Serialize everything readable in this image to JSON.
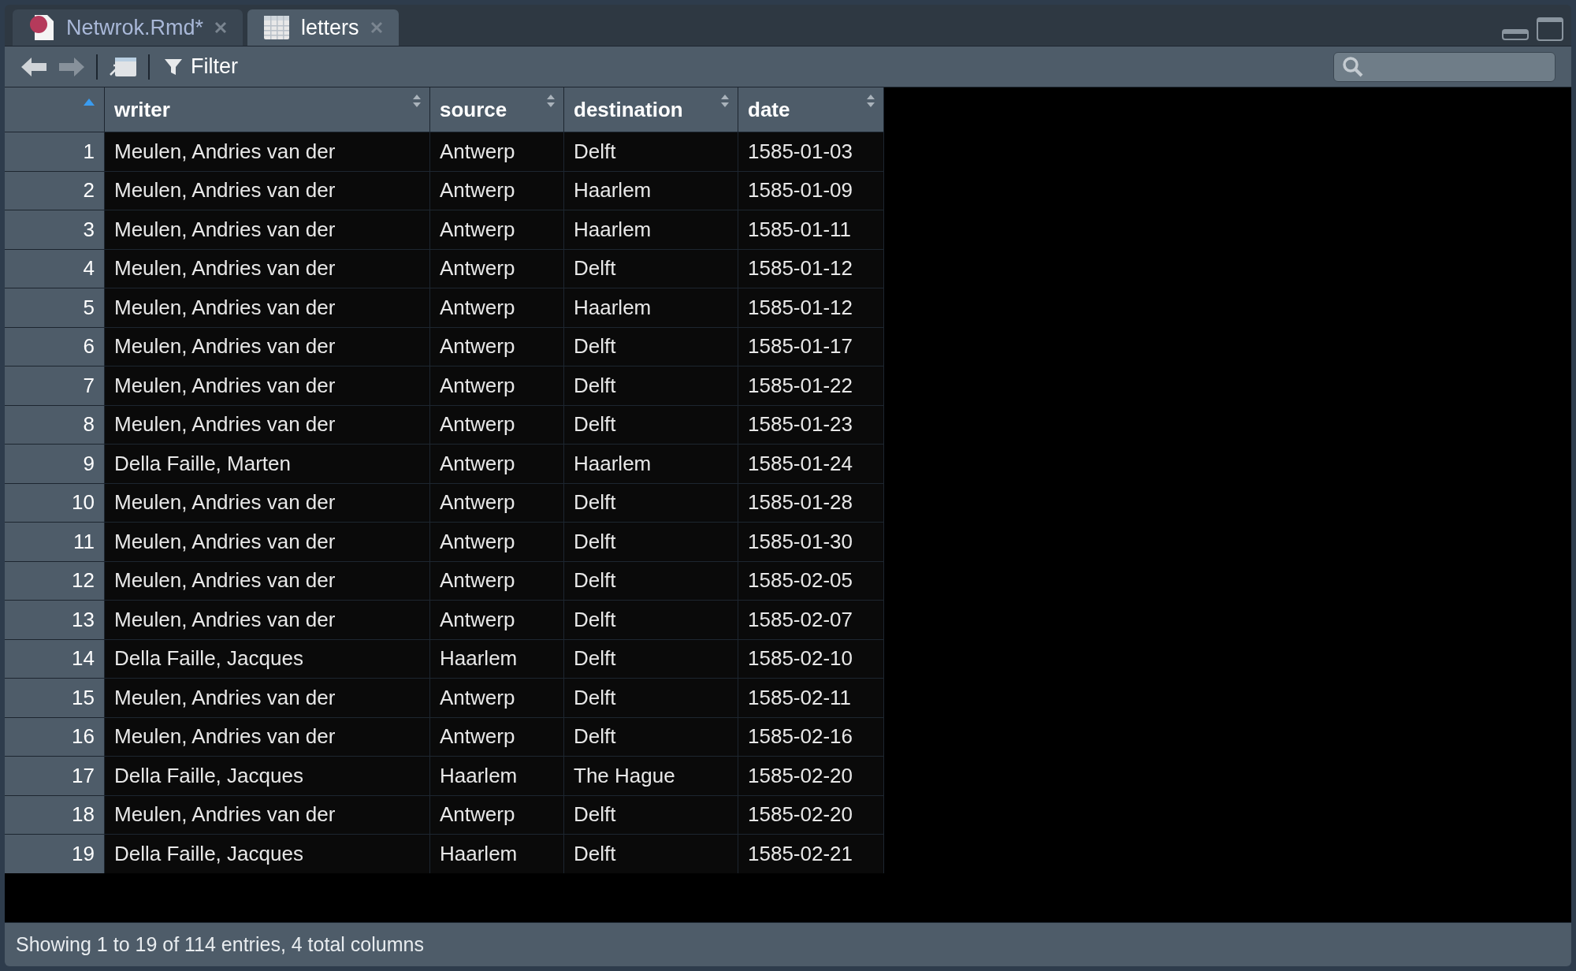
{
  "tabs": [
    {
      "label": "Netwrok.Rmd*",
      "kind": "rmd",
      "selected": false
    },
    {
      "label": "letters",
      "kind": "data",
      "selected": true
    }
  ],
  "toolbar": {
    "filter_label": "Filter"
  },
  "table": {
    "columns": [
      "writer",
      "source",
      "destination",
      "date"
    ],
    "rows": [
      {
        "row_number": "1",
        "cells": [
          "Meulen, Andries van der",
          "Antwerp",
          "Delft",
          "1585-01-03"
        ]
      },
      {
        "row_number": "2",
        "cells": [
          "Meulen, Andries van der",
          "Antwerp",
          "Haarlem",
          "1585-01-09"
        ]
      },
      {
        "row_number": "3",
        "cells": [
          "Meulen, Andries van der",
          "Antwerp",
          "Haarlem",
          "1585-01-11"
        ]
      },
      {
        "row_number": "4",
        "cells": [
          "Meulen, Andries van der",
          "Antwerp",
          "Delft",
          "1585-01-12"
        ]
      },
      {
        "row_number": "5",
        "cells": [
          "Meulen, Andries van der",
          "Antwerp",
          "Haarlem",
          "1585-01-12"
        ]
      },
      {
        "row_number": "6",
        "cells": [
          "Meulen, Andries van der",
          "Antwerp",
          "Delft",
          "1585-01-17"
        ]
      },
      {
        "row_number": "7",
        "cells": [
          "Meulen, Andries van der",
          "Antwerp",
          "Delft",
          "1585-01-22"
        ]
      },
      {
        "row_number": "8",
        "cells": [
          "Meulen, Andries van der",
          "Antwerp",
          "Delft",
          "1585-01-23"
        ]
      },
      {
        "row_number": "9",
        "cells": [
          "Della Faille, Marten",
          "Antwerp",
          "Haarlem",
          "1585-01-24"
        ]
      },
      {
        "row_number": "10",
        "cells": [
          "Meulen, Andries van der",
          "Antwerp",
          "Delft",
          "1585-01-28"
        ]
      },
      {
        "row_number": "11",
        "cells": [
          "Meulen, Andries van der",
          "Antwerp",
          "Delft",
          "1585-01-30"
        ]
      },
      {
        "row_number": "12",
        "cells": [
          "Meulen, Andries van der",
          "Antwerp",
          "Delft",
          "1585-02-05"
        ]
      },
      {
        "row_number": "13",
        "cells": [
          "Meulen, Andries van der",
          "Antwerp",
          "Delft",
          "1585-02-07"
        ]
      },
      {
        "row_number": "14",
        "cells": [
          "Della Faille, Jacques",
          "Haarlem",
          "Delft",
          "1585-02-10"
        ]
      },
      {
        "row_number": "15",
        "cells": [
          "Meulen, Andries van der",
          "Antwerp",
          "Delft",
          "1585-02-11"
        ]
      },
      {
        "row_number": "16",
        "cells": [
          "Meulen, Andries van der",
          "Antwerp",
          "Delft",
          "1585-02-16"
        ]
      },
      {
        "row_number": "17",
        "cells": [
          "Della Faille, Jacques",
          "Haarlem",
          "The Hague",
          "1585-02-20"
        ]
      },
      {
        "row_number": "18",
        "cells": [
          "Meulen, Andries van der",
          "Antwerp",
          "Delft",
          "1585-02-20"
        ]
      },
      {
        "row_number": "19",
        "cells": [
          "Della Faille, Jacques",
          "Haarlem",
          "Delft",
          "1585-02-21"
        ]
      }
    ]
  },
  "status_bar": "Showing 1 to 19 of 114 entries, 4 total columns"
}
